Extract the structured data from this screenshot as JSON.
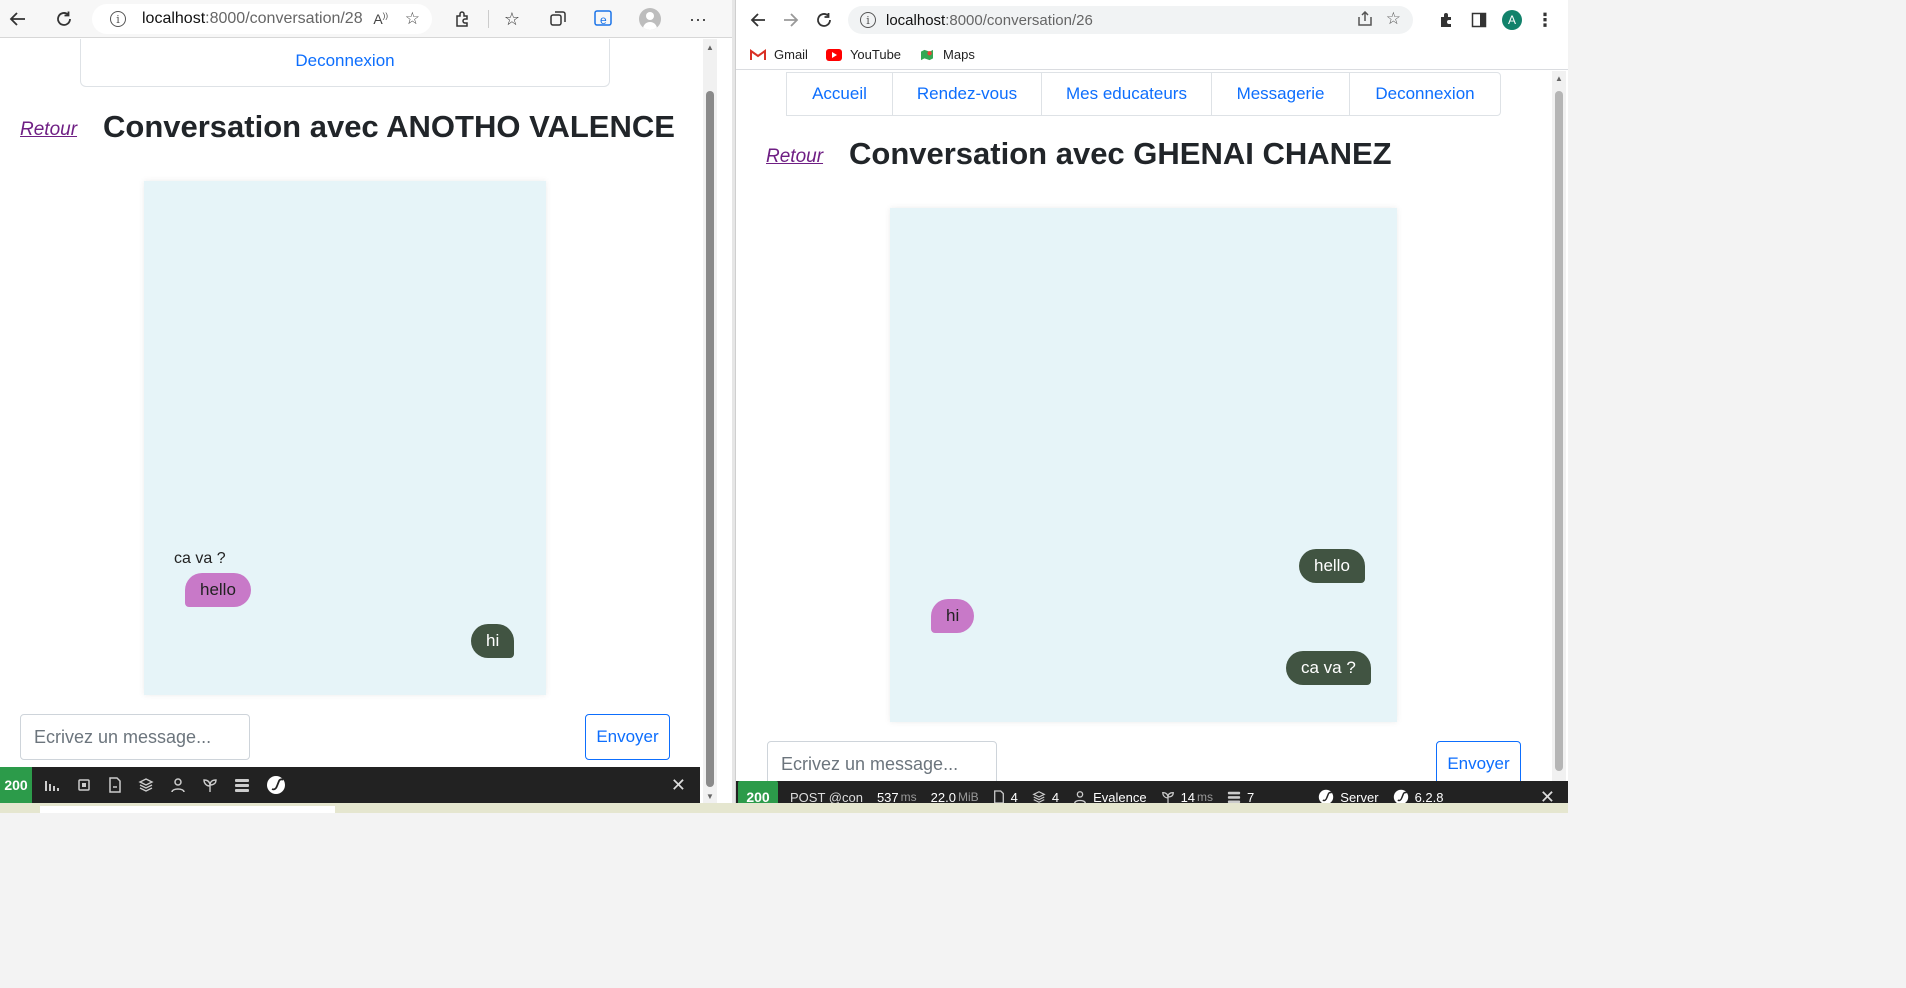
{
  "left_window": {
    "address": {
      "host": "localhost",
      "path": ":8000/conversation/28"
    },
    "nav": {
      "logout": "Deconnexion"
    },
    "back_label": "Retour",
    "title": "Conversation avec ANOTHO VALENCE",
    "messages": [
      {
        "text": "ca va ?",
        "kind": "plain"
      },
      {
        "text": "hello",
        "kind": "in"
      },
      {
        "text": "hi",
        "kind": "out"
      }
    ],
    "input_placeholder": "Ecrivez un message...",
    "send_label": "Envoyer",
    "debug_bar": {
      "status": "200"
    }
  },
  "right_window": {
    "address": {
      "host": "localhost",
      "path": ":8000/conversation/26"
    },
    "bookmarks": [
      "Gmail",
      "YouTube",
      "Maps"
    ],
    "profile_initial": "A",
    "nav": {
      "home": "Accueil",
      "appointments": "Rendez-vous",
      "educators": "Mes educateurs",
      "messages": "Messagerie",
      "logout": "Deconnexion"
    },
    "back_label": "Retour",
    "title": "Conversation avec GHENAI CHANEZ",
    "messages": [
      {
        "text": "hello",
        "kind": "out"
      },
      {
        "text": "hi",
        "kind": "in"
      },
      {
        "text": "ca va ?",
        "kind": "out"
      }
    ],
    "input_placeholder": "Ecrivez un message...",
    "send_label": "Envoyer",
    "debug_bar": {
      "status": "200",
      "request": "POST @con",
      "time": "537",
      "time_unit": "ms",
      "memory": "22.0",
      "memory_unit": "MiB",
      "forms": "4",
      "layers": "4",
      "user": "Evalence",
      "twig_time": "14",
      "twig_unit": "ms",
      "db": "7",
      "server": "Server",
      "version": "6.2.8"
    }
  },
  "colors": {
    "link": "#0d6efd",
    "chat_bg": "#e6f4f8",
    "bubble_out": "#415442",
    "bubble_in": "#c879c8",
    "back_link": "#6f1f84",
    "debug_ok": "#2c9b4a"
  }
}
